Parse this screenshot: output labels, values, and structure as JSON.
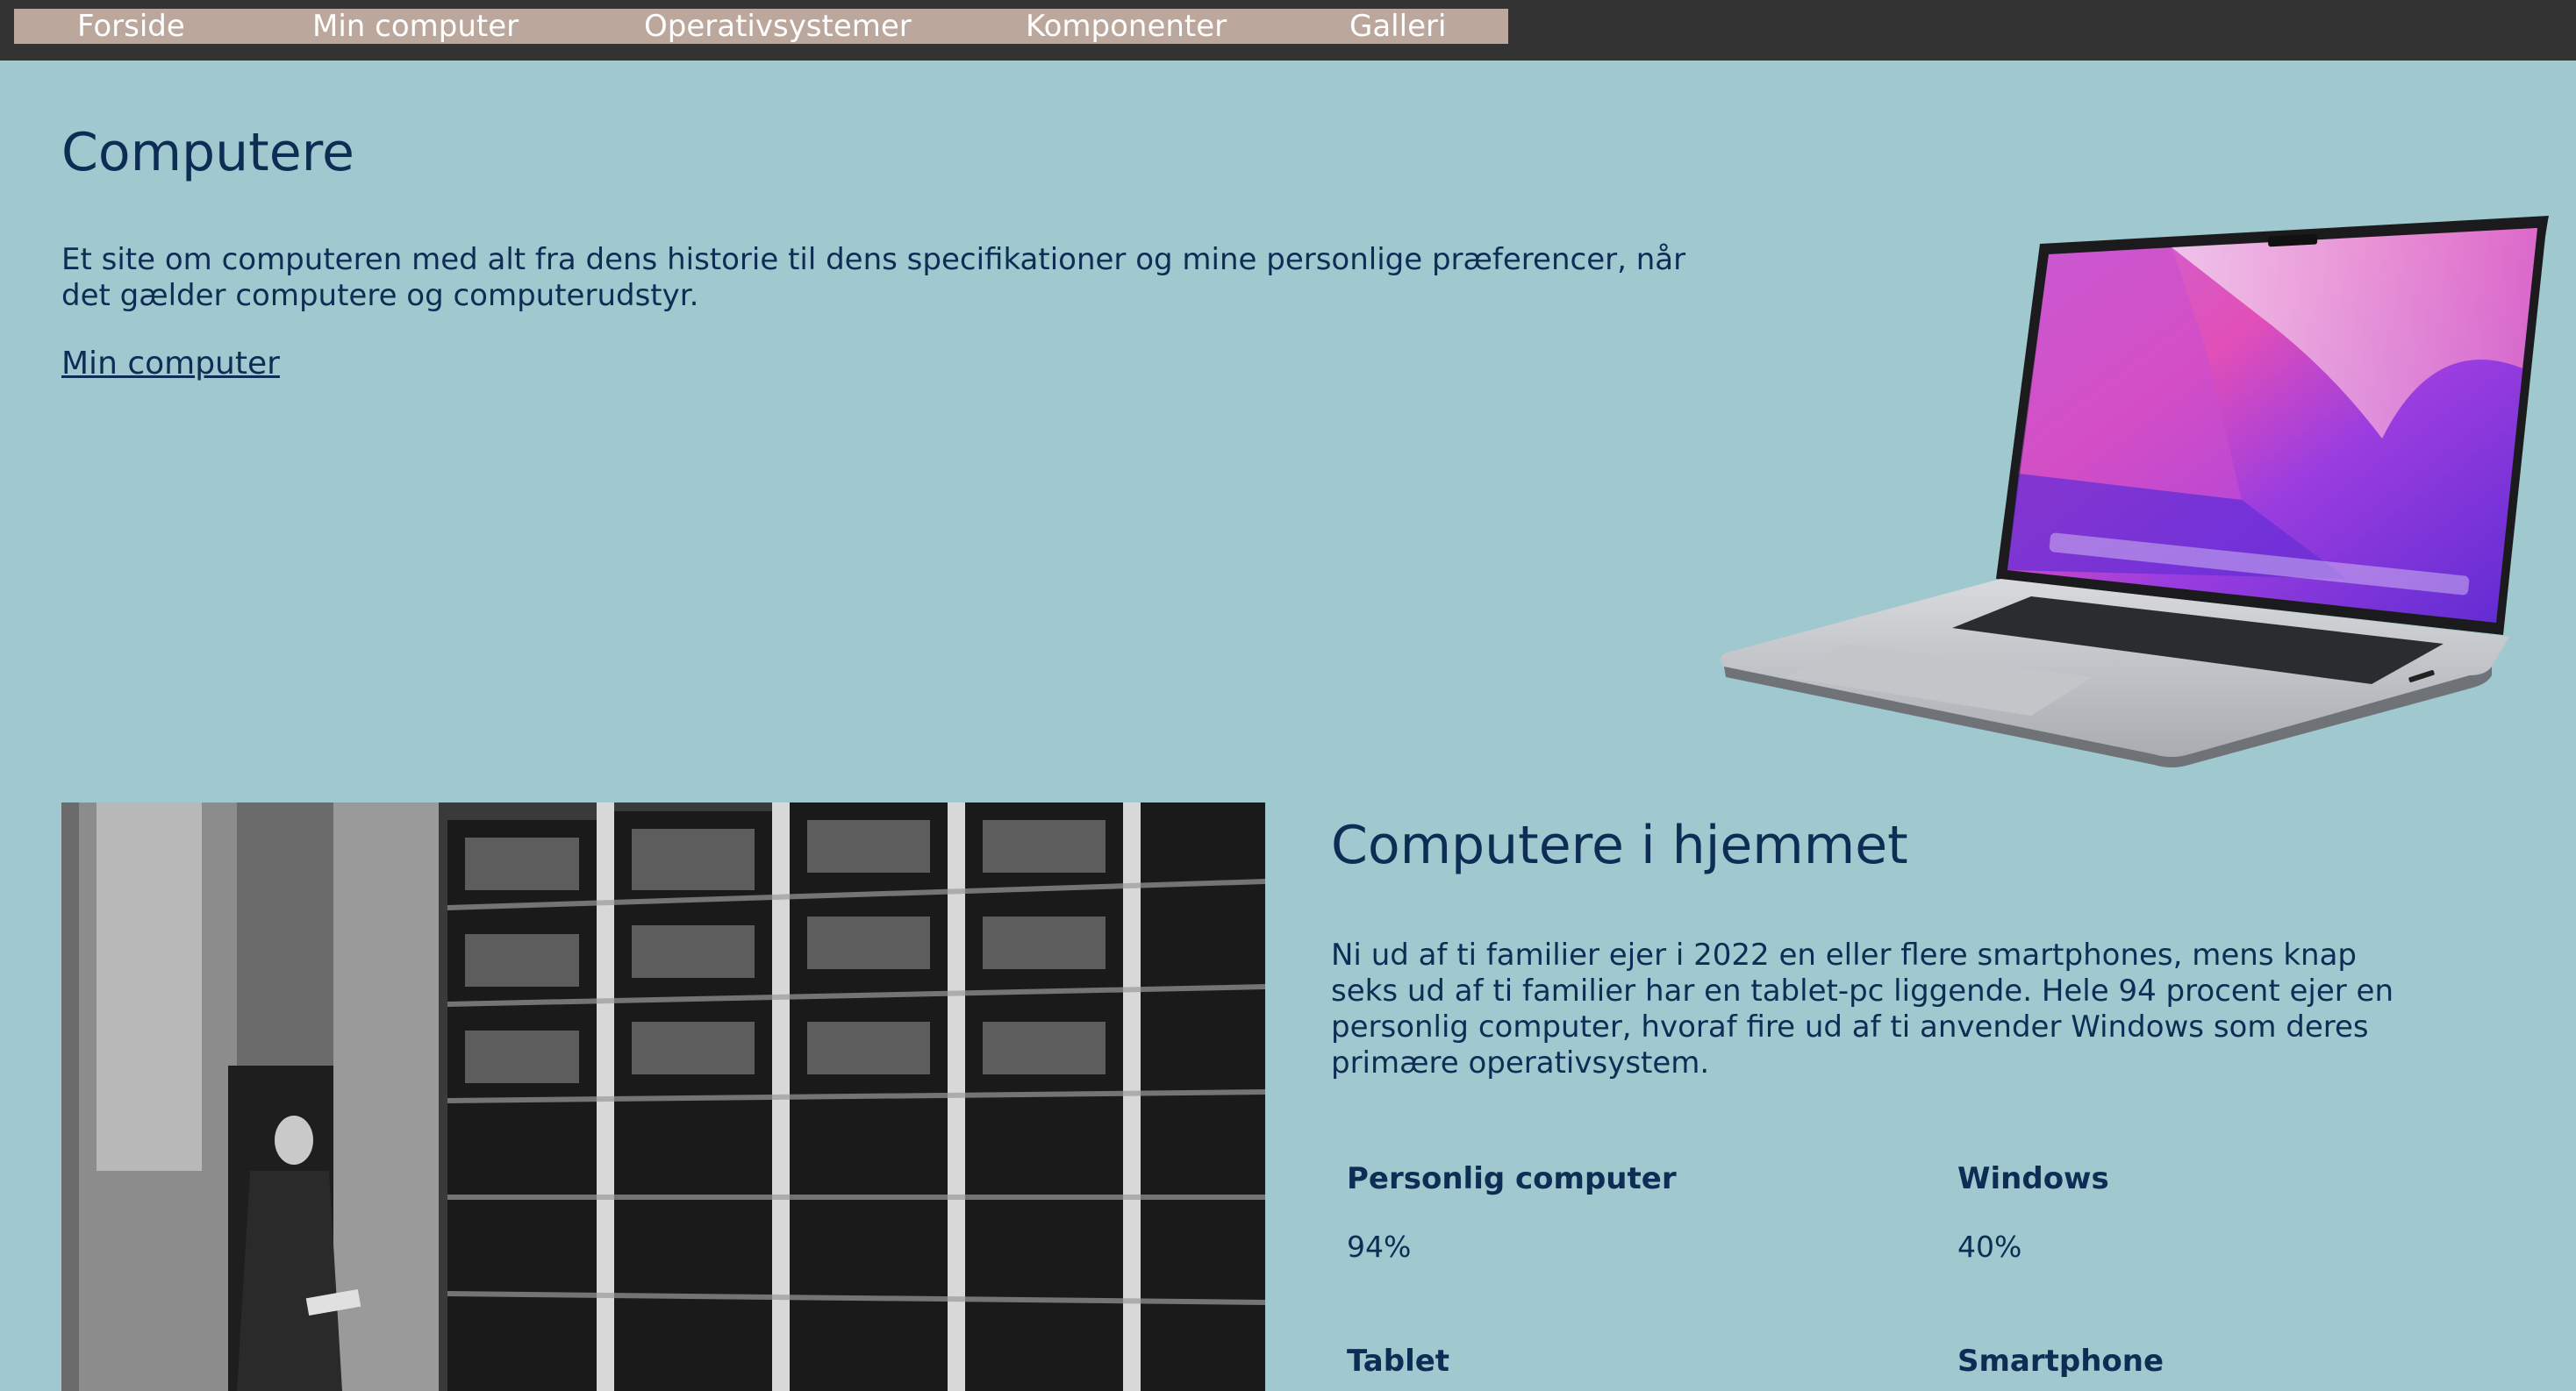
{
  "nav": {
    "items": [
      "Forside",
      "Min computer",
      "Operativsystemer",
      "Komponenter",
      "Galleri"
    ]
  },
  "hero": {
    "title": "Computere",
    "text": "Et site om computeren med alt fra dens historie til dens specifikationer og mine personlige præferencer, når det gælder computere og computerudstyr.",
    "link": "Min computer"
  },
  "home": {
    "title": "Computere i hjemmet",
    "text": "Ni ud af ti familier ejer i 2022 en eller flere smartphones, mens knap seks ud af ti familier har en tablet-pc liggende. Hele 94 procent ejer en personlig computer, hvoraf fire ud af ti anvender Windows som deres primære operativsystem.",
    "stats": [
      {
        "label": "Personlig computer",
        "value": "94%"
      },
      {
        "label": "Windows",
        "value": "40%"
      },
      {
        "label": "Tablet",
        "value": ""
      },
      {
        "label": "Smartphone",
        "value": ""
      }
    ]
  },
  "colors": {
    "background": "#a0c8cf",
    "topbar": "#333333",
    "nav": "#bca79c",
    "text": "#0d2d55"
  },
  "images": {
    "laptop": "laptop-illustration",
    "mainframe": "mainframe-computer-photo"
  }
}
